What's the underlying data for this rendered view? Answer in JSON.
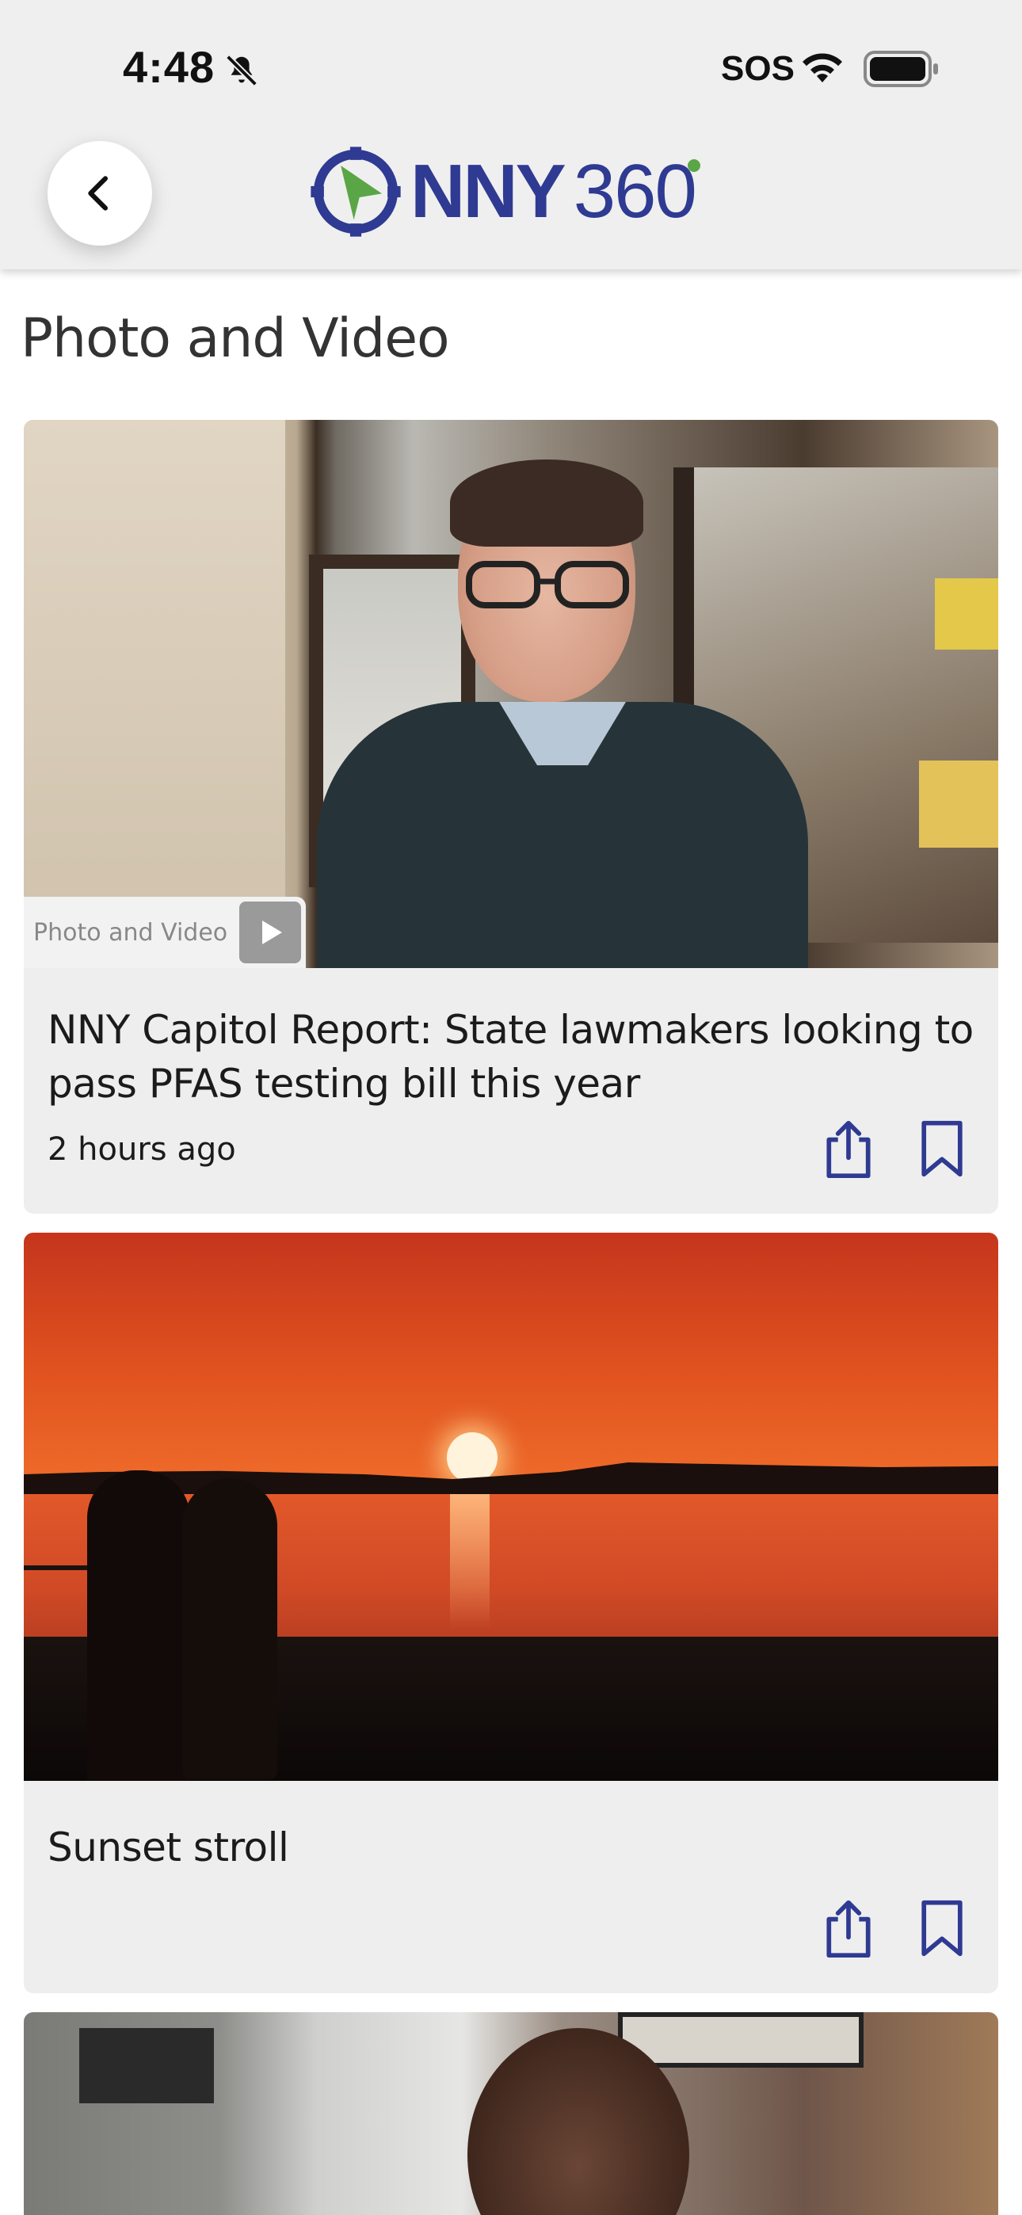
{
  "status_bar": {
    "time": "4:48",
    "sos": "SOS",
    "icons": [
      "bell-slash-icon",
      "wifi-icon",
      "battery-icon"
    ]
  },
  "header": {
    "back_icon": "chevron-left-icon",
    "logo_nny": "NNY",
    "logo_360": "360",
    "colors": {
      "brand_blue": "#2f3a92",
      "brand_green": "#5aa646",
      "header_bg": "#efefef"
    }
  },
  "page": {
    "title": "Photo and Video"
  },
  "cards": [
    {
      "media_tag": "Photo and Video",
      "media_icon": "play-icon",
      "title": "NNY Capitol Report: State lawmakers looking to pass PFAS testing bill this year",
      "timestamp": "2 hours ago",
      "actions": [
        "share-icon",
        "bookmark-icon"
      ]
    },
    {
      "title": "Sunset stroll",
      "timestamp": "",
      "actions": [
        "share-icon",
        "bookmark-icon"
      ]
    },
    {
      "title": "",
      "partial": true
    }
  ]
}
